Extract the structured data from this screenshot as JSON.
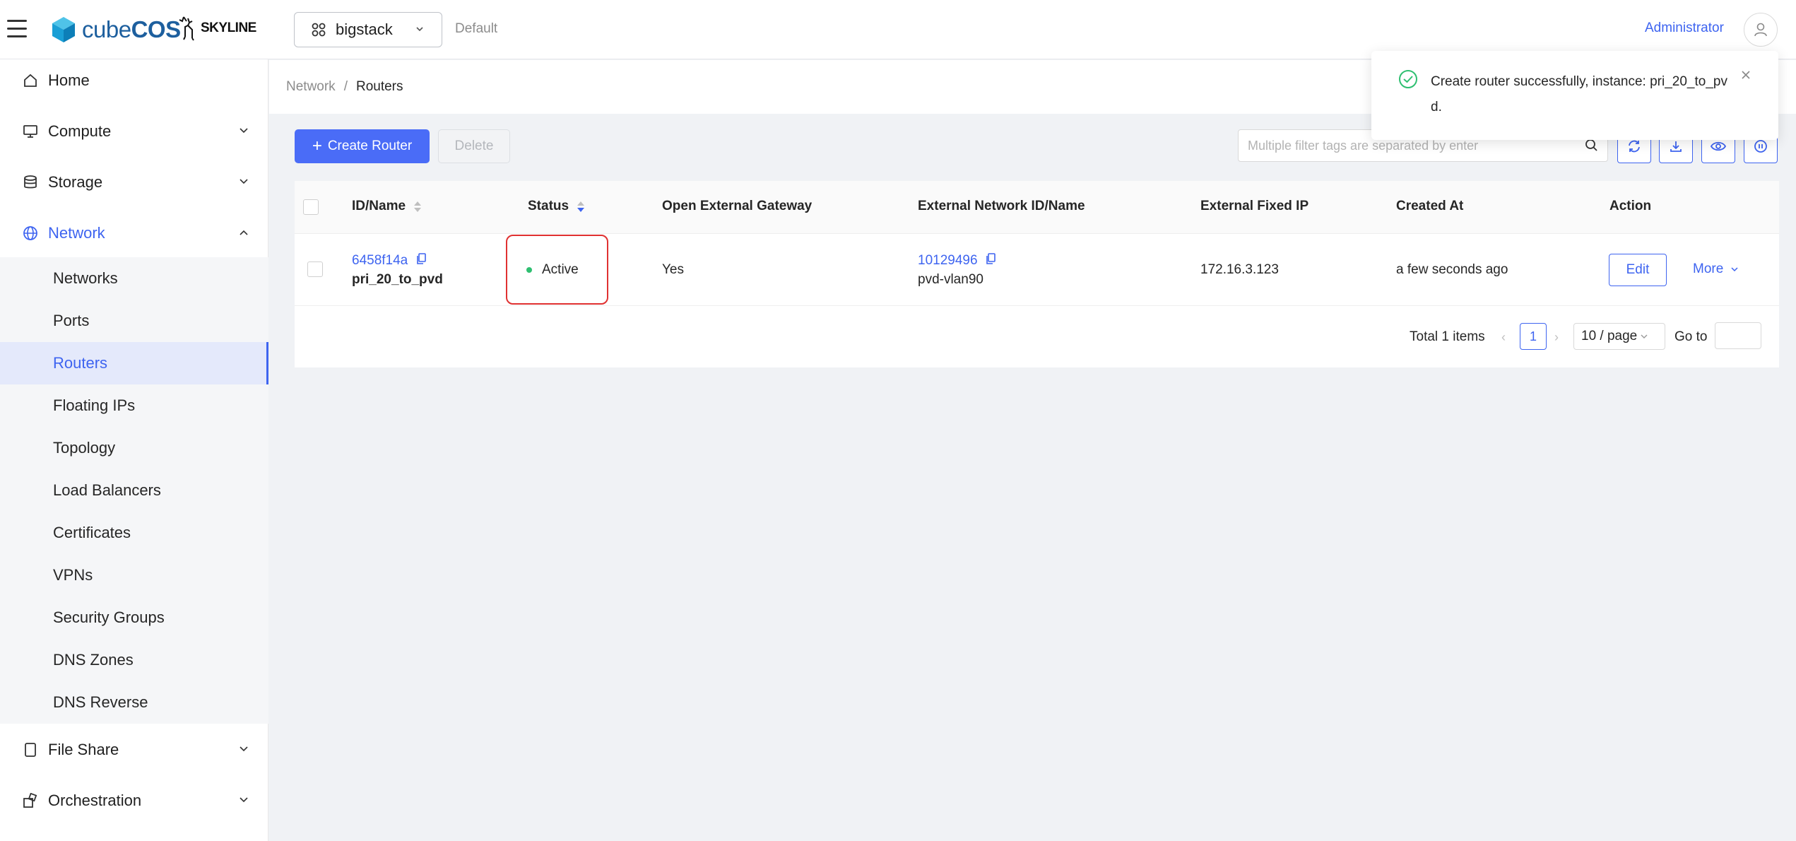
{
  "header": {
    "brand": "cubeCOS",
    "brand_light": "cube",
    "brand_bold": "COS",
    "partner": "SKYLINE",
    "project": "bigstack",
    "domain": "Default",
    "user": "Administrator"
  },
  "sidebar": {
    "items": [
      {
        "label": "Home",
        "icon": "home-icon"
      },
      {
        "label": "Compute",
        "icon": "monitor-icon"
      },
      {
        "label": "Storage",
        "icon": "database-icon"
      },
      {
        "label": "Network",
        "icon": "globe-icon"
      },
      {
        "label": "File Share",
        "icon": "file-icon"
      },
      {
        "label": "Orchestration",
        "icon": "orchestration-icon"
      }
    ],
    "network_sub": [
      "Networks",
      "Ports",
      "Routers",
      "Floating IPs",
      "Topology",
      "Load Balancers",
      "Certificates",
      "VPNs",
      "Security Groups",
      "DNS Zones",
      "DNS Reverse"
    ],
    "selected": "Routers"
  },
  "breadcrumb": {
    "parent": "Network",
    "separator": "/",
    "current": "Routers"
  },
  "toolbar": {
    "create_label": "Create Router",
    "delete_label": "Delete",
    "search_placeholder": "Multiple filter tags are separated by enter"
  },
  "table": {
    "columns": [
      "ID/Name",
      "Status",
      "Open External Gateway",
      "External Network ID/Name",
      "External Fixed IP",
      "Created At",
      "Action"
    ],
    "rows": [
      {
        "id": "6458f14a",
        "name": "pri_20_to_pvd",
        "status": "Active",
        "open_external_gateway": "Yes",
        "ext_net_id": "10129496",
        "ext_net_name": "pvd-vlan90",
        "fixed_ip": "172.16.3.123",
        "created_at": "a few seconds ago",
        "edit_label": "Edit",
        "more_label": "More"
      }
    ]
  },
  "pagination": {
    "total": "Total 1 items",
    "page": "1",
    "page_size": "10 / page",
    "goto": "Go to"
  },
  "notification": {
    "message": "Create router successfully, instance: pri_20_to_pvd."
  },
  "colors": {
    "accent": "#3e64f0",
    "success": "#2fbf71",
    "highlight": "#e03131"
  }
}
